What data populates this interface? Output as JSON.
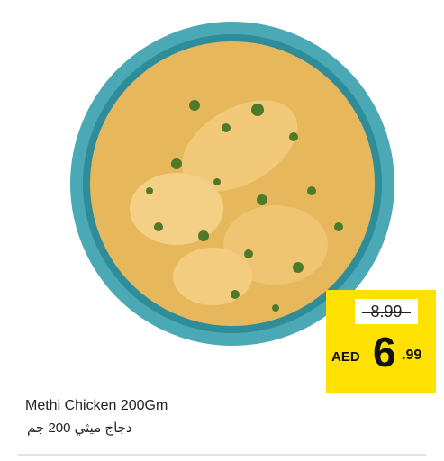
{
  "product": {
    "image_alt": "Methi Chicken in a blue bowl",
    "name_en": "Methi Chicken 200Gm",
    "name_ar": "دجاج ميثي 200 جم"
  },
  "price": {
    "old": "8.99",
    "currency": "AED",
    "integer": "6",
    "decimal": ".99"
  },
  "colors": {
    "price_tag": "#ffe100",
    "bowl": "#4aa9b5",
    "curry": "#e7b85b"
  }
}
